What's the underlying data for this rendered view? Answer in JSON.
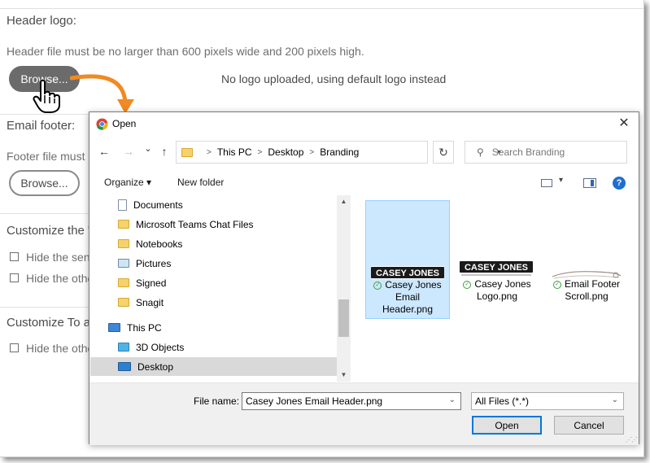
{
  "background": {
    "header_logo_label": "Header logo:",
    "header_hint": "Header file must be no larger than 600 pixels wide and 200 pixels high.",
    "browse_label": "Browse...",
    "no_logo_text": "No logo uploaded, using default logo instead",
    "email_footer_label": "Email footer:",
    "footer_hint_partial": "Footer file must b",
    "browse2_label": "Browse...",
    "customize_label_partial": "Customize the \"",
    "check1_partial": "Hide the send",
    "check2_partial": "Hide the othe",
    "customize_to_partial": "Customize To ar",
    "check3_partial": "Hide the othe",
    "arrow_color": "#f08a24"
  },
  "dialog": {
    "title": "Open",
    "close_glyph": "✕",
    "nav": {
      "back": "←",
      "forward": "→",
      "recent": "⌄",
      "up": "↑"
    },
    "breadcrumb": [
      "This PC",
      "Desktop",
      "Branding"
    ],
    "refresh_glyph": "↻",
    "search_placeholder": "Search Branding",
    "organize_label": "Organize ▾",
    "new_folder_label": "New folder",
    "help_glyph": "?",
    "tree": [
      {
        "label": "Documents",
        "icon": "document-icon"
      },
      {
        "label": "Microsoft Teams Chat Files",
        "icon": "folder-icon"
      },
      {
        "label": "Notebooks",
        "icon": "folder-icon"
      },
      {
        "label": "Pictures",
        "icon": "pictures-icon"
      },
      {
        "label": "Signed",
        "icon": "folder-icon"
      },
      {
        "label": "Snagit",
        "icon": "folder-icon"
      },
      {
        "label": "This PC",
        "icon": "computer-icon"
      },
      {
        "label": "3D Objects",
        "icon": "cube-icon"
      },
      {
        "label": "Desktop",
        "icon": "desktop-icon",
        "selected": true
      }
    ],
    "files": [
      {
        "name": "Casey Jones Email Header.png",
        "line1": "Casey Jones",
        "line2": "Email",
        "line3": "Header.png",
        "thumb_text": "CASEY JONES",
        "selected": true
      },
      {
        "name": "Casey Jones Logo.png",
        "line1": "Casey Jones",
        "line2": "Logo.png",
        "thumb_text": "CASEY JONES",
        "selected": false
      },
      {
        "name": "Email Footer Scroll.png",
        "line1": "Email Footer",
        "line2": "Scroll.png",
        "thumb_text": "",
        "selected": false
      }
    ],
    "file_name_label": "File name:",
    "file_name_value": "Casey Jones Email Header.png",
    "file_type_value": "All Files (*.*)",
    "open_button": "Open",
    "cancel_button": "Cancel",
    "accent_color": "#0078d7",
    "selection_color": "#cce8ff"
  }
}
